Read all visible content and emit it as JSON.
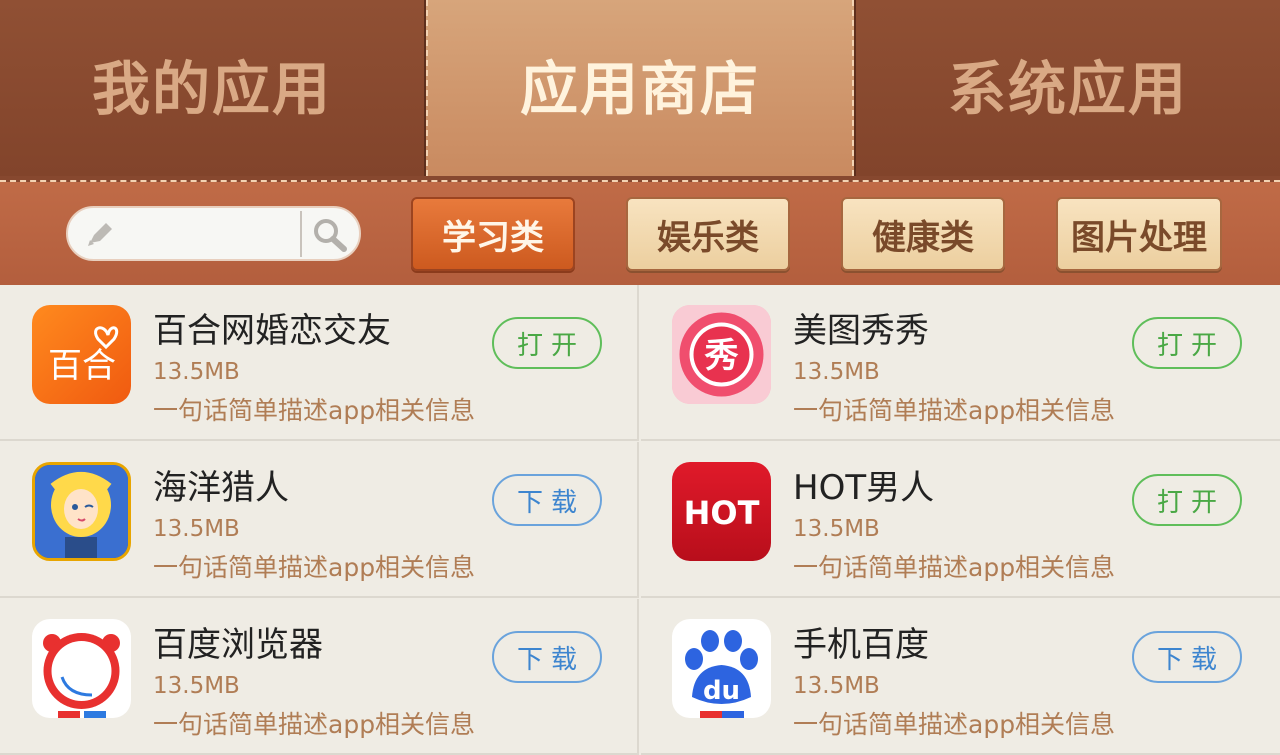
{
  "tabs": [
    {
      "label": "我的应用",
      "active": false
    },
    {
      "label": "应用商店",
      "active": true
    },
    {
      "label": "系统应用",
      "active": false
    }
  ],
  "search": {
    "value": "",
    "placeholder": ""
  },
  "categories": [
    {
      "label": "学习类",
      "active": true
    },
    {
      "label": "娱乐类",
      "active": false
    },
    {
      "label": "健康类",
      "active": false
    },
    {
      "label": "图片处理",
      "active": false
    }
  ],
  "apps": [
    {
      "name": "百合网婚恋交友",
      "size": "13.5MB",
      "desc": "一句话简单描述app相关信息",
      "action": "打开",
      "icon": "baihe-icon",
      "icon_text": "百合"
    },
    {
      "name": "美图秀秀",
      "size": "13.5MB",
      "desc": "一句话简单描述app相关信息",
      "action": "打开",
      "icon": "meitu-icon",
      "icon_text": "秀"
    },
    {
      "name": "海洋猎人",
      "size": "13.5MB",
      "desc": "一句话简单描述app相关信息",
      "action": "下载",
      "icon": "ocean-hunter-icon"
    },
    {
      "name": "HOT男人",
      "size": "13.5MB",
      "desc": "一句话简单描述app相关信息",
      "action": "打开",
      "icon": "hot-icon",
      "icon_text": "HOT"
    },
    {
      "name": "百度浏览器",
      "size": "13.5MB",
      "desc": "一句话简单描述app相关信息",
      "action": "下载",
      "icon": "baidu-browser-icon"
    },
    {
      "name": "手机百度",
      "size": "13.5MB",
      "desc": "一句话简单描述app相关信息",
      "action": "下载",
      "icon": "baidu-paw-icon",
      "icon_text": "du"
    }
  ],
  "colors": {
    "tab_bg": "#87482f",
    "tab_active": "#d7a57b",
    "bar_bg": "#c06b47",
    "open_green": "#5fbe5a",
    "download_blue": "#6aa3dc"
  }
}
